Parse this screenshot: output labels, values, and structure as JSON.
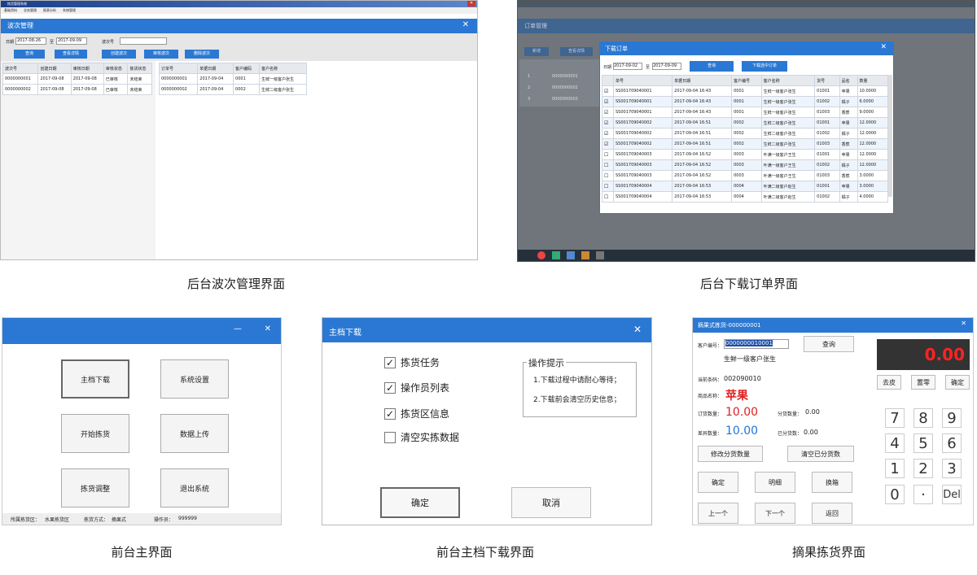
{
  "panel1": {
    "window_title": "拣货管理系统",
    "menu": [
      "基础资料",
      "业务管理",
      "报表分析",
      "系统管理"
    ],
    "tab_title": "波次管理",
    "date_label": "日期",
    "date_from": "2017-08-26",
    "to_label": "至",
    "date_to": "2017-09-09",
    "wave_no_label": "波次号",
    "buttons": [
      "查询",
      "查看详情",
      "创建波次",
      "审核波次",
      "删除波次"
    ],
    "left_headers": [
      "波次号",
      "创建日期",
      "审核日期",
      "审核状态",
      "拣货状态"
    ],
    "left_rows": [
      [
        "0000000001",
        "2017-09-08",
        "2017-09-08",
        "已审核",
        "未结束"
      ],
      [
        "0000000002",
        "2017-09-08",
        "2017-09-08",
        "已审核",
        "未结束"
      ]
    ],
    "right_headers": [
      "订单号",
      "单据日期",
      "客户编码",
      "客户名称"
    ],
    "right_rows": [
      [
        "0000000001",
        "2017-09-04",
        "0001",
        "生鲜一级客户张生"
      ],
      [
        "0000000002",
        "2017-09-04",
        "0002",
        "生鲜二级客户张生"
      ]
    ]
  },
  "panel2": {
    "bg_tab_title": "订单管理",
    "bg_buttons": [
      "新增",
      "查看详情"
    ],
    "bg_rows": [
      [
        "1",
        "0000000001"
      ],
      [
        "2",
        "0000000002"
      ],
      [
        "3",
        "0000000003"
      ]
    ],
    "dialog_title": "下载订单",
    "date_label": "日期",
    "date_from": "2017-09-02",
    "to_label": "至",
    "date_to": "2017-09-09",
    "query_btn": "查询",
    "download_btn": "下载选中订单",
    "headers": [
      "单号",
      "单据日期",
      "客户编号",
      "客户名称",
      "货号",
      "品名",
      "数量"
    ],
    "rows": [
      [
        "SS001709040001",
        "2017-09-04 16:43",
        "0001",
        "生鲜一级客户张生",
        "01001",
        "苹果",
        "10.0000",
        true
      ],
      [
        "SS001709040001",
        "2017-09-04 16:43",
        "0001",
        "生鲜一级客户张生",
        "01002",
        "橘子",
        "6.0000",
        true
      ],
      [
        "SS001709040001",
        "2017-09-04 16:43",
        "0001",
        "生鲜一级客户张生",
        "01003",
        "香蕉",
        "9.0000",
        true
      ],
      [
        "SS001709040002",
        "2017-09-04 16:51",
        "0002",
        "生鲜二级客户张生",
        "01001",
        "苹果",
        "12.0000",
        true
      ],
      [
        "SS001709040002",
        "2017-09-04 16:51",
        "0002",
        "生鲜二级客户张生",
        "01002",
        "橘子",
        "12.0000",
        true
      ],
      [
        "SS001709040002",
        "2017-09-04 16:51",
        "0002",
        "生鲜二级客户张生",
        "01003",
        "香蕉",
        "12.0000",
        true
      ],
      [
        "SS001709040003",
        "2017-09-04 16:52",
        "0003",
        "叶满一级客户王生",
        "01001",
        "苹果",
        "12.0000",
        false
      ],
      [
        "SS001709040003",
        "2017-09-04 16:52",
        "0003",
        "叶满一级客户王生",
        "01002",
        "橘子",
        "12.0000",
        false
      ],
      [
        "SS001709040003",
        "2017-09-04 16:52",
        "0003",
        "叶满一级客户王生",
        "01003",
        "香蕉",
        "3.0000",
        false
      ],
      [
        "SS001709040004",
        "2017-09-04 16:53",
        "0004",
        "叶满二级客户赵生",
        "01001",
        "苹果",
        "3.0000",
        false
      ],
      [
        "SS001709040004",
        "2017-09-04 16:53",
        "0004",
        "叶满二级客户赵生",
        "01002",
        "橘子",
        "4.0000",
        false
      ]
    ]
  },
  "panel3": {
    "tiles": [
      "主档下载",
      "系统设置",
      "开始拣货",
      "数据上传",
      "拣货调整",
      "退出系统"
    ],
    "status": [
      "所属拣货区：",
      "水果拣货区",
      "拣货方式：",
      "摘果式",
      "操作员：",
      "999999"
    ]
  },
  "panel4": {
    "title": "主档下载",
    "checks": [
      {
        "label": "拣货任务",
        "checked": true
      },
      {
        "label": "操作员列表",
        "checked": true
      },
      {
        "label": "拣货区信息",
        "checked": true
      },
      {
        "label": "清空实拣数据",
        "checked": false
      }
    ],
    "tip_title": "操作提示",
    "tip_lines": [
      "1.下载过程中请耐心等待；",
      "2.下载前会清空历史信息；"
    ],
    "ok": "确定",
    "cancel": "取消"
  },
  "panel5": {
    "title": "摘果式拣货-000000001",
    "customer_label": "客户编号：",
    "customer_value": "0000000010001",
    "query": "查询",
    "customer_name": "生鲜一级客户张生",
    "barcode_label": "当前条码：",
    "barcode": "002090010",
    "product_label": "商品名称：",
    "product": "苹果",
    "order_qty_label": "订货数量：",
    "order_qty": "10.00",
    "sorted_qty_label": "分货数量：",
    "sorted_qty": "0.00",
    "diff_label": "差异数量：",
    "diff": "10.00",
    "done_label": "已分货数：",
    "done": "0.00",
    "btn_modify": "修改分货数量",
    "btn_clear": "清空已分货数",
    "buttons": [
      "确定",
      "明细",
      "换箱",
      "上一个",
      "下一个",
      "返回"
    ],
    "scale": "0.00",
    "scale_btns": [
      "去皮",
      "置零",
      "确定"
    ],
    "keys": [
      "7",
      "8",
      "9",
      "4",
      "5",
      "6",
      "1",
      "2",
      "3",
      "0",
      "·",
      "Del"
    ]
  },
  "captions": [
    "后台波次管理界面",
    "后台下载订单界面",
    "前台主界面",
    "前台主档下载界面",
    "摘果拣货界面"
  ]
}
